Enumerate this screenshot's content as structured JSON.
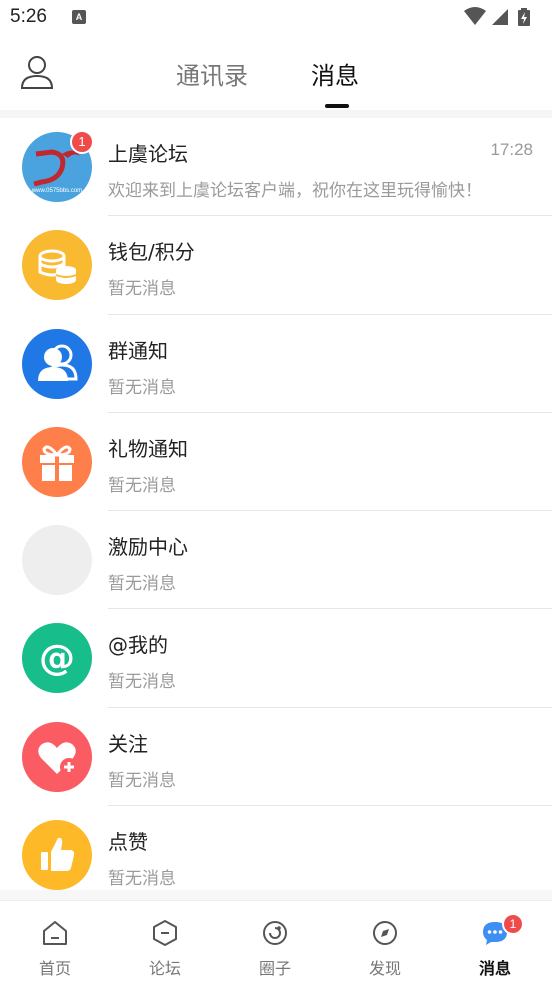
{
  "status_bar": {
    "time": "5:26",
    "notification_icon": "a-icon",
    "icons": [
      "wifi-icon",
      "signal-icon",
      "battery-charging-icon"
    ]
  },
  "header": {
    "profile_icon": "person-icon",
    "tabs": [
      {
        "label": "通讯录",
        "active": false
      },
      {
        "label": "消息",
        "active": true
      }
    ]
  },
  "messages": [
    {
      "title": "上虞论坛",
      "subtitle": "欢迎来到上虞论坛客户端，祝你在这里玩得愉快！",
      "time": "17:28",
      "badge": "1",
      "icon": "forum-logo-icon",
      "color": "#4aa3df"
    },
    {
      "title": "钱包/积分",
      "subtitle": "暂无消息",
      "icon": "coins-icon",
      "color": "#f9b931"
    },
    {
      "title": "群通知",
      "subtitle": "暂无消息",
      "icon": "group-icon",
      "color": "#1f78e6"
    },
    {
      "title": "礼物通知",
      "subtitle": "暂无消息",
      "icon": "gift-icon",
      "color": "#ff7f4b"
    },
    {
      "title": "激励中心",
      "subtitle": "暂无消息",
      "icon": "placeholder-icon",
      "color": "#eeeeee"
    },
    {
      "title": "@我的",
      "subtitle": "暂无消息",
      "icon": "at-icon",
      "color": "#17bd8a"
    },
    {
      "title": "关注",
      "subtitle": "暂无消息",
      "icon": "heart-plus-icon",
      "color": "#fb5b63"
    },
    {
      "title": "点赞",
      "subtitle": "暂无消息",
      "icon": "thumbs-up-icon",
      "color": "#fdb927"
    }
  ],
  "bottom_nav": [
    {
      "label": "首页",
      "icon": "home-icon",
      "active": false
    },
    {
      "label": "论坛",
      "icon": "forum-icon",
      "active": false
    },
    {
      "label": "圈子",
      "icon": "circle-icon",
      "active": false
    },
    {
      "label": "发现",
      "icon": "discover-icon",
      "active": false
    },
    {
      "label": "消息",
      "icon": "chat-icon",
      "active": true,
      "badge": "1",
      "color": "#3d8ef5"
    }
  ]
}
